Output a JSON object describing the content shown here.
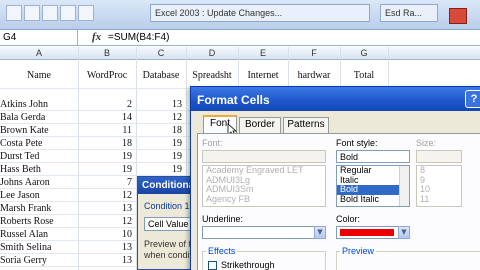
{
  "topbar": {
    "search_text": "Excel 2003 : Update Changes...",
    "subtitle_text": "Esd Ra...",
    "accent_color": "#d84b3a"
  },
  "formula_bar": {
    "name_box": "G4",
    "fx_label": "fx",
    "formula": "=SUM(B4:F4)"
  },
  "columns": [
    "A",
    "B",
    "C",
    "D",
    "E",
    "F",
    "G"
  ],
  "sheet": {
    "headers": [
      "Name",
      "WordProc",
      "Database",
      "Spreadsht",
      "Internet",
      "hardwar",
      "Total"
    ],
    "rows": [
      {
        "name": "Atkins John",
        "b": "2",
        "c": "13"
      },
      {
        "name": "Bala Gerda",
        "b": "14",
        "c": "12"
      },
      {
        "name": "Brown Kate",
        "b": "11",
        "c": "18"
      },
      {
        "name": "Costa Pete",
        "b": "18",
        "c": "19"
      },
      {
        "name": "Durst Ted",
        "b": "19",
        "c": "19"
      },
      {
        "name": "Hass Beth",
        "b": "19",
        "c": "19"
      },
      {
        "name": "Johns Aaron",
        "b": "7",
        "c": ""
      },
      {
        "name": "Lee Jason",
        "b": "12",
        "c": ""
      },
      {
        "name": "Marsh Frank",
        "b": "13",
        "c": ""
      },
      {
        "name": "Roberts Rose",
        "b": "12",
        "c": ""
      },
      {
        "name": "Russel Alan",
        "b": "10",
        "c": ""
      },
      {
        "name": "Smith Selina",
        "b": "13",
        "c": ""
      },
      {
        "name": "Soria Gerry",
        "b": "13",
        "c": ""
      }
    ]
  },
  "conditional_dialog": {
    "title": "Conditional Formatting",
    "group_label": "Condition 1",
    "select_value": "Cell Value Is",
    "preview_line1": "Preview of format to use",
    "preview_line2": "when condition is true:"
  },
  "format_cells": {
    "title": "Format Cells",
    "help": "?",
    "tabs": [
      "Font",
      "Border",
      "Patterns"
    ],
    "active_tab": "Font",
    "font_label": "Font:",
    "font_list": [
      "Academy Engraved LET",
      "ADMUI3Lg",
      "ADMUI3Sm",
      "Agency FB"
    ],
    "style_label": "Font style:",
    "style_value": "Bold",
    "style_list": [
      "Regular",
      "Italic",
      "Bold",
      "Bold Italic"
    ],
    "style_selected": "Bold",
    "size_label": "Size:",
    "size_list": [
      "8",
      "9",
      "10",
      "11"
    ],
    "underline_label": "Underline:",
    "color_label": "Color:",
    "color_value": "#ee0000",
    "effects_label": "Effects",
    "strikethrough_label": "Strikethrough",
    "preview_label": "Preview"
  }
}
